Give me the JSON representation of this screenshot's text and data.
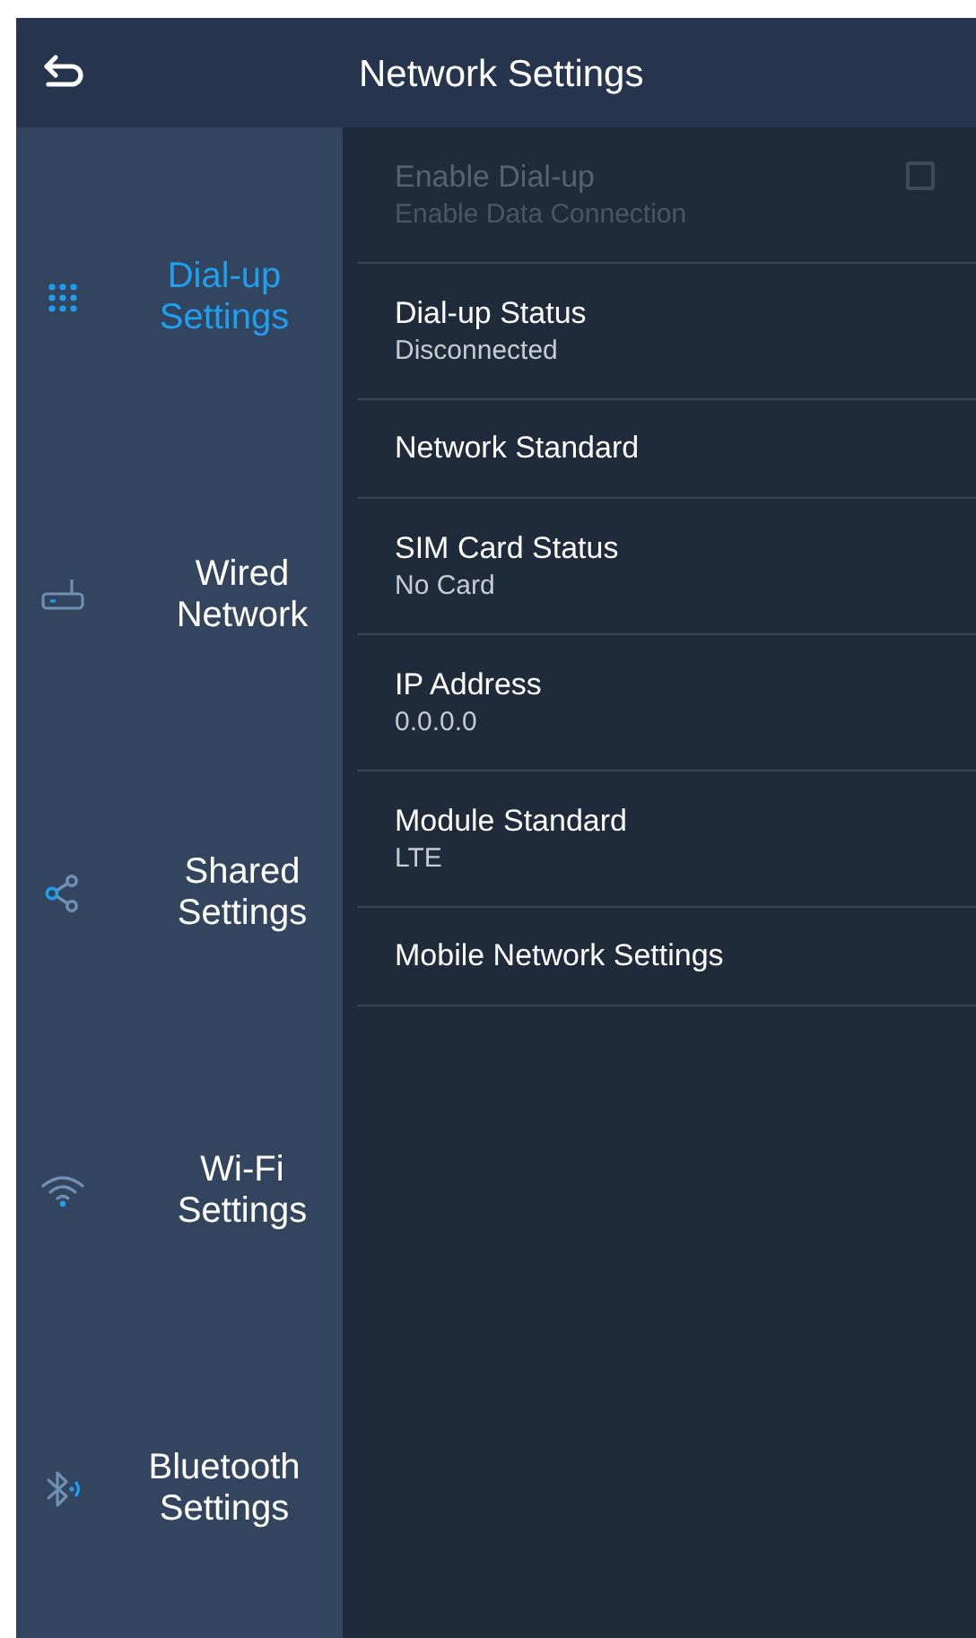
{
  "header": {
    "title": "Network Settings"
  },
  "sidebar": {
    "items": [
      {
        "label": "Dial-up Settings",
        "kind": "dialpad",
        "selected": true
      },
      {
        "label": "Wired Network",
        "kind": "router",
        "selected": false
      },
      {
        "label": "Shared Settings",
        "kind": "share",
        "selected": false
      },
      {
        "label": "Wi-Fi Settings",
        "kind": "wifi",
        "selected": false
      },
      {
        "label": "Bluetooth Settings",
        "kind": "bluetooth",
        "selected": false
      }
    ]
  },
  "settings": [
    {
      "title": "Enable Dial-up",
      "subtitle": "Enable Data Connection",
      "kind": "checkbox",
      "checked": false,
      "disabled": true
    },
    {
      "title": "Dial-up Status",
      "subtitle": "Disconnected",
      "kind": "info",
      "disabled": false
    },
    {
      "title": "Network Standard",
      "kind": "info",
      "disabled": false
    },
    {
      "title": "SIM Card Status",
      "subtitle": "No Card",
      "kind": "info",
      "disabled": false
    },
    {
      "title": "IP Address",
      "subtitle": "0.0.0.0",
      "kind": "info",
      "disabled": false
    },
    {
      "title": "Module Standard",
      "subtitle": "LTE",
      "kind": "info",
      "disabled": false
    },
    {
      "title": "Mobile Network Settings",
      "kind": "info",
      "disabled": false
    }
  ]
}
